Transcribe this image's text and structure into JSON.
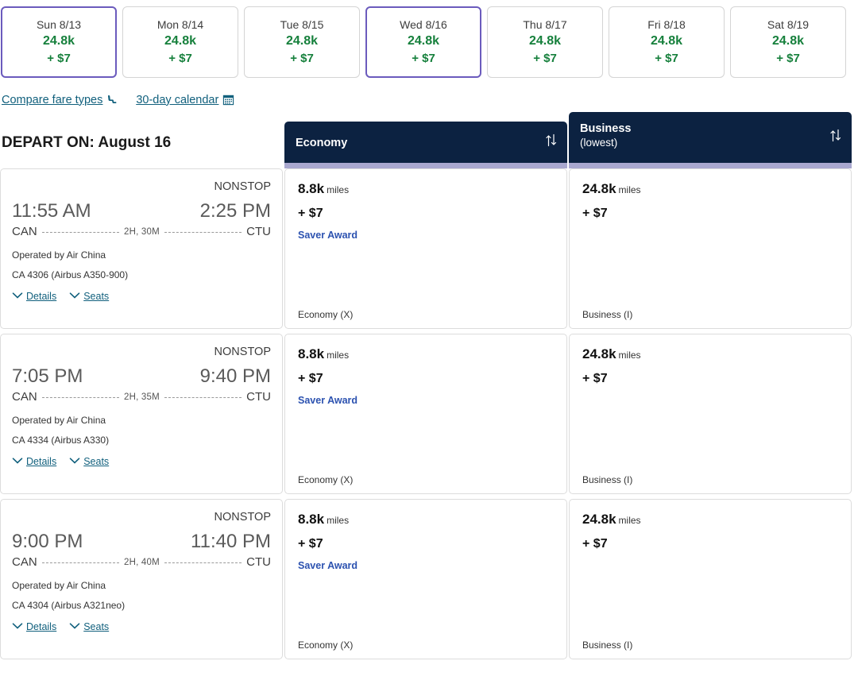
{
  "date_strip": {
    "tabs": [
      {
        "day": "Sun 8/13",
        "miles": "24.8k",
        "cash": "+ $7",
        "selected": true
      },
      {
        "day": "Mon 8/14",
        "miles": "24.8k",
        "cash": "+ $7",
        "selected": false
      },
      {
        "day": "Tue 8/15",
        "miles": "24.8k",
        "cash": "+ $7",
        "selected": false
      },
      {
        "day": "Wed 8/16",
        "miles": "24.8k",
        "cash": "+ $7",
        "selected": true
      },
      {
        "day": "Thu 8/17",
        "miles": "24.8k",
        "cash": "+ $7",
        "selected": false
      },
      {
        "day": "Fri 8/18",
        "miles": "24.8k",
        "cash": "+ $7",
        "selected": false
      },
      {
        "day": "Sat 8/19",
        "miles": "24.8k",
        "cash": "+ $7",
        "selected": false
      }
    ]
  },
  "links": {
    "compare_fare_types": "Compare fare types",
    "compare_icon": "seat-icon",
    "thirty_day_calendar": "30-day calendar",
    "calendar_icon": "calendar-icon"
  },
  "results": {
    "depart_title": "DEPART ON: August 16",
    "columns": [
      {
        "title": "Economy",
        "subtitle": "",
        "sort_icon": "sort-updown-icon"
      },
      {
        "title": "Business",
        "subtitle": "(lowest)",
        "sort_icon": "sort-updown-icon"
      }
    ],
    "flights": [
      {
        "stops": "NONSTOP",
        "depart_time": "11:55 AM",
        "arrive_time": "2:25 PM",
        "origin": "CAN",
        "destination": "CTU",
        "duration": "2H, 30M",
        "operated_by": "Operated by Air China",
        "flight_info": "CA 4306 (Airbus A350-900)",
        "details_label": "Details",
        "seats_label": "Seats",
        "fares": [
          {
            "miles": "8.8k",
            "unit": "miles",
            "cash": "+ $7",
            "tag": "Saver Award",
            "cabin": "Economy (X)"
          },
          {
            "miles": "24.8k",
            "unit": "miles",
            "cash": "+ $7",
            "tag": "",
            "cabin": "Business (I)"
          }
        ]
      },
      {
        "stops": "NONSTOP",
        "depart_time": "7:05 PM",
        "arrive_time": "9:40 PM",
        "origin": "CAN",
        "destination": "CTU",
        "duration": "2H, 35M",
        "operated_by": "Operated by Air China",
        "flight_info": "CA 4334 (Airbus A330)",
        "details_label": "Details",
        "seats_label": "Seats",
        "fares": [
          {
            "miles": "8.8k",
            "unit": "miles",
            "cash": "+ $7",
            "tag": "Saver Award",
            "cabin": "Economy (X)"
          },
          {
            "miles": "24.8k",
            "unit": "miles",
            "cash": "+ $7",
            "tag": "",
            "cabin": "Business (I)"
          }
        ]
      },
      {
        "stops": "NONSTOP",
        "depart_time": "9:00 PM",
        "arrive_time": "11:40 PM",
        "origin": "CAN",
        "destination": "CTU",
        "duration": "2H, 40M",
        "operated_by": "Operated by Air China",
        "flight_info": "CA 4304 (Airbus A321neo)",
        "details_label": "Details",
        "seats_label": "Seats",
        "fares": [
          {
            "miles": "8.8k",
            "unit": "miles",
            "cash": "+ $7",
            "tag": "Saver Award",
            "cabin": "Economy (X)"
          },
          {
            "miles": "24.8k",
            "unit": "miles",
            "cash": "+ $7",
            "tag": "",
            "cabin": "Business (I)"
          }
        ]
      }
    ]
  },
  "colors": {
    "selected_tab_border": "#6b5bbd",
    "miles_green": "#16803c",
    "header_navy": "#0c2241",
    "header_strip": "#a9a8cf",
    "link_teal": "#11607d",
    "saver_blue": "#2c52b0"
  }
}
